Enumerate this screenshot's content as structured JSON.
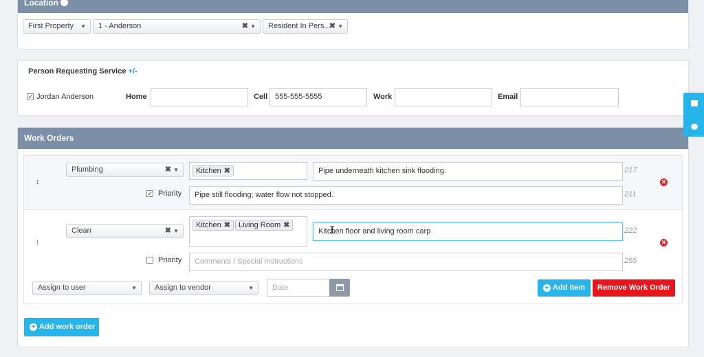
{
  "location": {
    "title": "Location",
    "property": "First Property",
    "unit": "1 - Anderson",
    "resident": "Resident In Pers..."
  },
  "person": {
    "title": "Person Requesting Service",
    "toggle": "+/-",
    "name": "Jordan Anderson",
    "home_label": "Home",
    "home_value": "",
    "cell_label": "Cell",
    "cell_value": "555-555-5555",
    "work_label": "Work",
    "work_value": "",
    "email_label": "Email",
    "email_value": ""
  },
  "work_orders": {
    "title": "Work Orders",
    "items": [
      {
        "category": "Plumbing",
        "tags": [
          "Kitchen"
        ],
        "description": "Pipe underneath kitchen sink flooding.",
        "desc_remaining": "217",
        "priority_label": "Priority",
        "priority_checked": true,
        "comment": "Pipe still flooding; water flow not stopped.",
        "comment_remaining": "211"
      },
      {
        "category": "Clean",
        "tags": [
          "Kitchen",
          "Living Room"
        ],
        "description": "Kitchen floor and living room carp",
        "desc_remaining": "222",
        "priority_label": "Priority",
        "priority_checked": false,
        "comment_placeholder": "Comments / Special Instructions",
        "comment_remaining": "255"
      }
    ],
    "assign_user": "Assign to user",
    "assign_vendor": "Assign to vendor",
    "date_placeholder": "Date",
    "add_item": "Add item",
    "remove_work_order": "Remove Work Order",
    "add_work_order": "Add work order"
  },
  "colors": {
    "header": "#7b8fa6",
    "accent": "#27b4ea",
    "danger": "#e8151b"
  }
}
